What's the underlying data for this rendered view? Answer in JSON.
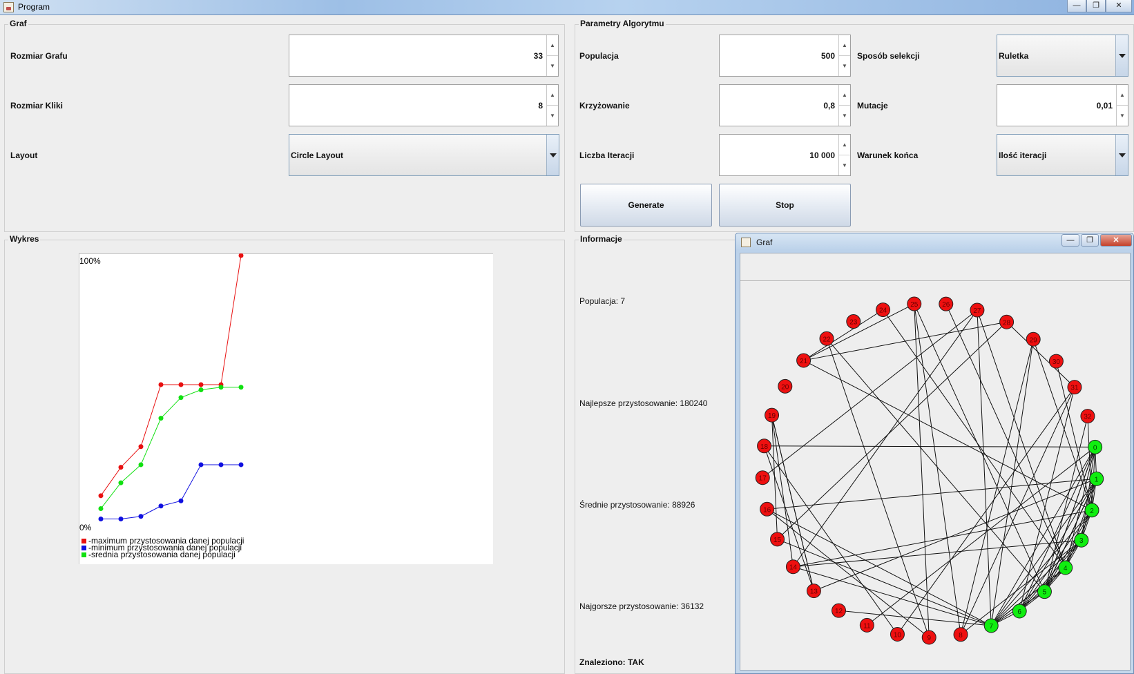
{
  "window": {
    "title": "Program",
    "minimize": "—",
    "maximize": "❐",
    "close": "✕"
  },
  "graf_panel": {
    "title": "Graf",
    "rozmiar_grafu": {
      "label": "Rozmiar Grafu",
      "value": "33"
    },
    "rozmiar_kliki": {
      "label": "Rozmiar Kliki",
      "value": "8"
    },
    "layout": {
      "label": "Layout",
      "value": "Circle Layout"
    }
  },
  "algorithm_panel": {
    "title": "Parametry Algorytmu",
    "populacja": {
      "label": "Populacja",
      "value": "500"
    },
    "krzyzowanie": {
      "label": "Krzyżowanie",
      "value": "0,8"
    },
    "liczba_iteracji": {
      "label": "Liczba Iteracji",
      "value": "10 000"
    },
    "sposob_selekcji": {
      "label": "Sposób selekcji",
      "value": "Ruletka"
    },
    "mutacje": {
      "label": "Mutacje",
      "value": "0,01"
    },
    "warunek_konca": {
      "label": "Warunek końca",
      "value": "Ilość iteracji"
    },
    "generate_label": "Generate",
    "stop_label": "Stop"
  },
  "wykres_panel": {
    "title": "Wykres"
  },
  "info_panel": {
    "title": "Informacje",
    "populacja": "Populacja: 7",
    "najlepsze": "Najlepsze przystosowanie: 180240",
    "srednie": "Średnie przystosowanie: 88926",
    "najgorsze": "Najgorsze przystosowanie: 36132",
    "znaleziono": "Znaleziono: TAK"
  },
  "chart_data": {
    "type": "line",
    "x": [
      1,
      2,
      3,
      4,
      5,
      6,
      7,
      8
    ],
    "ylim": [
      0,
      100
    ],
    "y_top_label": "100%",
    "y_bottom_label": "0%",
    "series": [
      {
        "name": "-maximum przystosowania danej populacji",
        "color": "#e81010",
        "values": [
          7,
          18,
          26,
          50,
          50,
          50,
          50,
          100
        ]
      },
      {
        "name": "-minimum przystosowania danej populacji",
        "color": "#1010e0",
        "values": [
          -2,
          -2,
          -1,
          3,
          5,
          19,
          19,
          19
        ]
      },
      {
        "name": "-srednia przystosowania danej populacji",
        "color": "#10e010",
        "values": [
          2,
          12,
          19,
          37,
          45,
          48,
          49,
          49
        ]
      }
    ]
  },
  "graph_window": {
    "title": "Graf",
    "node_count": 33,
    "green_nodes": [
      "0",
      "1",
      "2",
      "3",
      "4",
      "5",
      "6",
      "7"
    ],
    "node_labels": [
      "0",
      "1",
      "2",
      "3",
      "4",
      "5",
      "6",
      "7",
      "8",
      "9",
      "10",
      "11",
      "12",
      "13",
      "14",
      "15",
      "16",
      "17",
      "18",
      "19",
      "20",
      "21",
      "22",
      "23",
      "24",
      "25",
      "26",
      "27",
      "28",
      "29",
      "30",
      "31",
      "32"
    ],
    "colors": {
      "clique": "#10ee10",
      "other": "#ee1010"
    }
  }
}
